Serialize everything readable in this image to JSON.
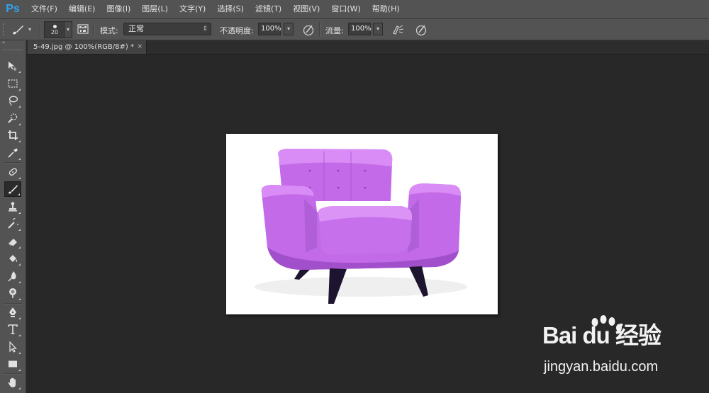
{
  "app": {
    "logo_text": "Ps"
  },
  "menu": [
    "文件(F)",
    "编辑(E)",
    "图像(I)",
    "图层(L)",
    "文字(Y)",
    "选择(S)",
    "滤镜(T)",
    "视图(V)",
    "窗口(W)",
    "帮助(H)"
  ],
  "options": {
    "brush_size": "20",
    "mode_label": "模式:",
    "mode_value": "正常",
    "opacity_label": "不透明度:",
    "opacity_value": "100%",
    "flow_label": "流量:",
    "flow_value": "100%"
  },
  "document_tab": {
    "title": "5-49.jpg @ 100%(RGB/8#) *",
    "close": "×"
  },
  "toolbox": {
    "collapse_glyph": "»",
    "tools": [
      {
        "name": "move-tool-icon"
      },
      {
        "name": "marquee-tool-icon"
      },
      {
        "name": "lasso-tool-icon"
      },
      {
        "name": "quick-selection-tool-icon"
      },
      {
        "name": "crop-tool-icon"
      },
      {
        "name": "eyedropper-tool-icon"
      },
      {
        "name": "healing-brush-tool-icon"
      },
      {
        "name": "brush-tool-icon",
        "active": true
      },
      {
        "name": "clone-stamp-tool-icon"
      },
      {
        "name": "history-brush-tool-icon"
      },
      {
        "name": "eraser-tool-icon"
      },
      {
        "name": "paint-bucket-tool-icon"
      },
      {
        "name": "blur-tool-icon"
      },
      {
        "name": "dodge-tool-icon"
      },
      {
        "name": "pen-tool-icon"
      },
      {
        "name": "type-tool-icon"
      },
      {
        "name": "path-selection-tool-icon"
      },
      {
        "name": "rectangle-tool-icon"
      },
      {
        "name": "hand-tool-icon"
      }
    ]
  },
  "canvas_image": {
    "subject": "purple-armchair"
  },
  "watermark": {
    "brand_text": "Bai du 经验",
    "url": "jingyan.baidu.com"
  },
  "colors": {
    "ui_panel": "#535353",
    "workspace": "#282828",
    "ps_logo": "#2fa3f0",
    "sofa": "#c36ae8",
    "sofa_shadow": "#a24fcc",
    "sofa_legs": "#1d1530"
  }
}
